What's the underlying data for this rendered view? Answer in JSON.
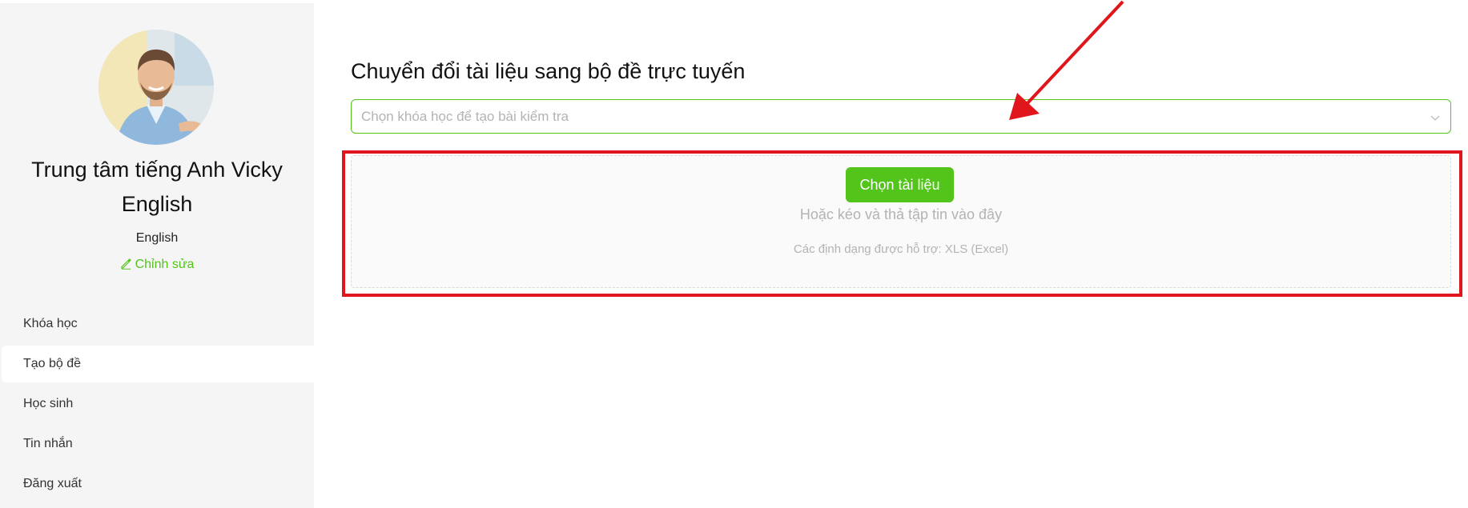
{
  "profile": {
    "name": "Trung tâm tiếng Anh Vicky English",
    "subject": "English",
    "edit_label": "Chỉnh sửa"
  },
  "sidebar": {
    "items": [
      {
        "label": "Khóa học"
      },
      {
        "label": "Tạo bộ đề",
        "active": true
      },
      {
        "label": "Học sinh"
      },
      {
        "label": "Tin nhắn"
      },
      {
        "label": "Đăng xuất"
      }
    ]
  },
  "main": {
    "title": "Chuyển đổi tài liệu sang bộ đề trực tuyến",
    "course_select": {
      "placeholder": "Chọn khóa học để tạo bài kiểm tra"
    },
    "upload": {
      "button_label": "Chọn tài liệu",
      "hint": "Hoặc kéo và thả tập tin vào đây",
      "formats": "Các định dạng được hỗ trợ: XLS (Excel)"
    }
  },
  "colors": {
    "accent": "#52c41a",
    "annotation": "#e0161c",
    "sidebar_bg": "#f5f5f5"
  },
  "icons": {
    "edit": "pencil-icon",
    "select": "chevron-down-icon"
  }
}
